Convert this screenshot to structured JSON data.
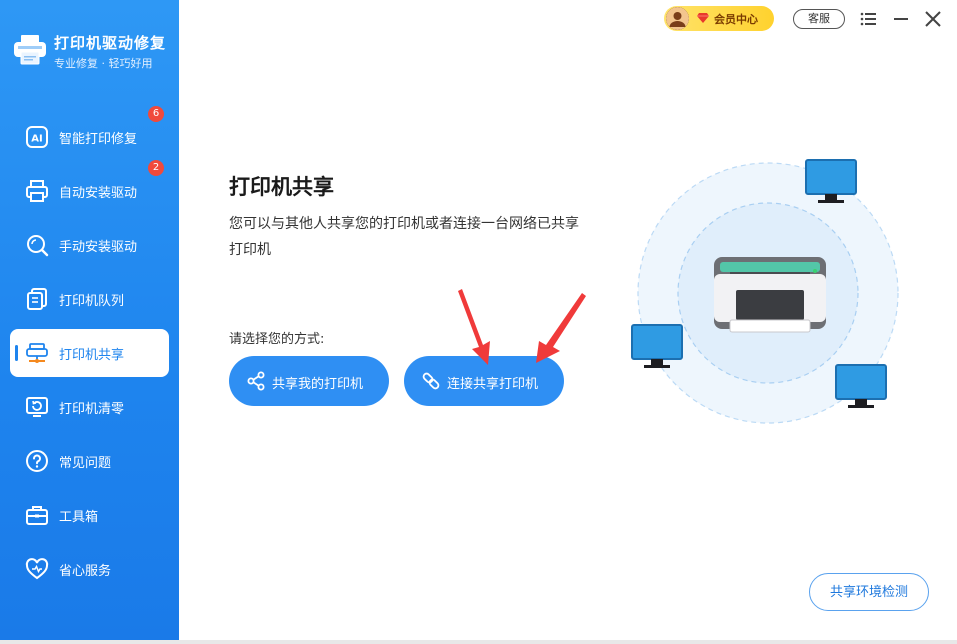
{
  "app": {
    "title": "打印机驱动修复",
    "subtitle": "专业修复 · 轻巧好用"
  },
  "topbar": {
    "vip_label": "会员中心",
    "service_label": "客服",
    "menu_icon": "menu-icon",
    "minimize_icon": "minimize-icon",
    "close_icon": "close-icon"
  },
  "sidebar": {
    "items": [
      {
        "label": "智能打印修复",
        "badge": "6",
        "icon": "ai-icon"
      },
      {
        "label": "自动安装驱动",
        "badge": "2",
        "icon": "printer-icon"
      },
      {
        "label": "手动安装驱动",
        "badge": "",
        "icon": "search-icon"
      },
      {
        "label": "打印机队列",
        "badge": "",
        "icon": "document-icon"
      },
      {
        "label": "打印机共享",
        "badge": "",
        "icon": "share-network-icon",
        "active": true
      },
      {
        "label": "打印机清零",
        "badge": "",
        "icon": "reset-icon"
      },
      {
        "label": "常见问题",
        "badge": "",
        "icon": "question-icon"
      },
      {
        "label": "工具箱",
        "badge": "",
        "icon": "toolbox-icon"
      },
      {
        "label": "省心服务",
        "badge": "",
        "icon": "heart-icon"
      }
    ]
  },
  "main": {
    "title": "打印机共享",
    "description": "您可以与其他人共享您的打印机或者连接一台网络已共享打印机",
    "choose_label": "请选择您的方式:",
    "share_button": "共享我的打印机",
    "connect_button": "连接共享打印机",
    "check_button": "共享环境检测"
  },
  "colors": {
    "sidebar": "#1e84ee",
    "accent": "#2f8ff3",
    "badge": "#f04a3c",
    "vip": "#ffd22e",
    "arrow": "#f03a3a"
  }
}
